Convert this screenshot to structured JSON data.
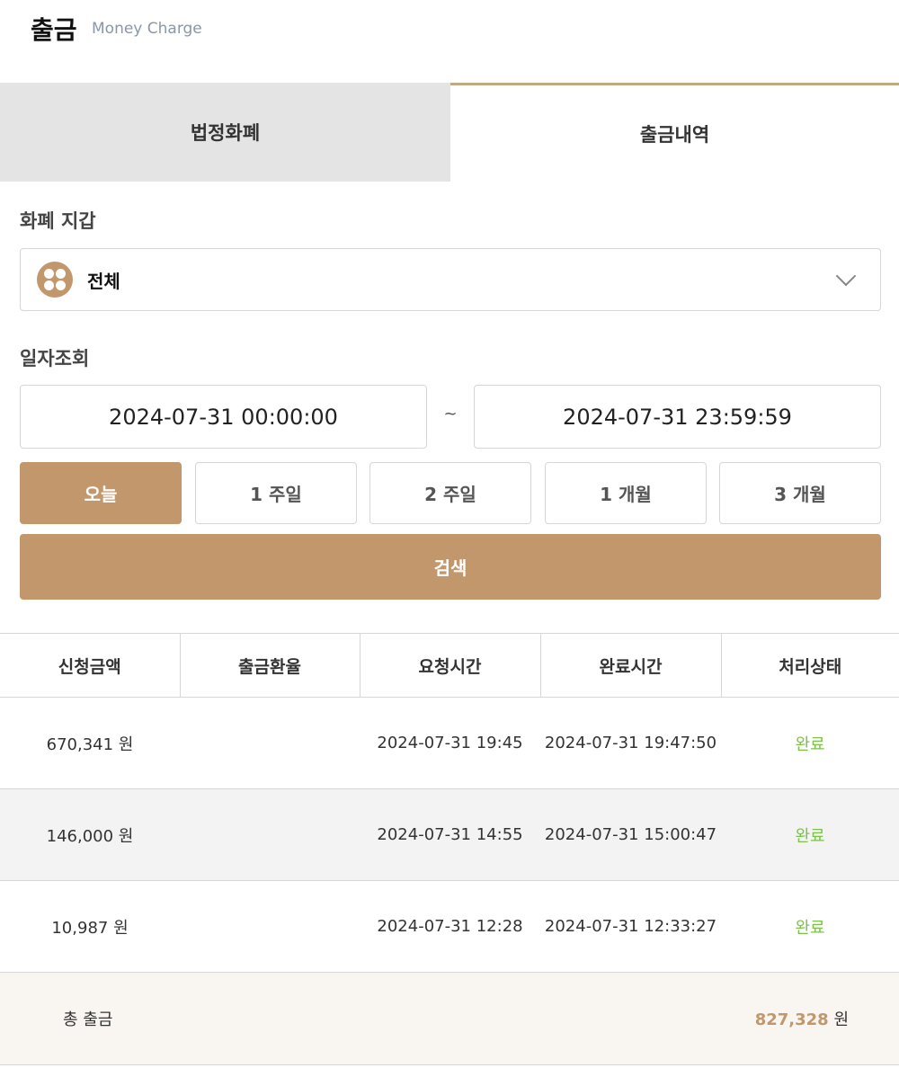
{
  "header": {
    "title": "출금",
    "subtitle": "Money Charge"
  },
  "tabs": [
    {
      "label": "법정화폐",
      "active": false
    },
    {
      "label": "출금내역",
      "active": true
    }
  ],
  "wallet": {
    "label": "화폐 지갑",
    "selected": "전체",
    "icon": "coin-icon"
  },
  "date_query": {
    "label": "일자조회",
    "start": "2024-07-31 00:00:00",
    "separator": "~",
    "end": "2024-07-31 23:59:59"
  },
  "periods": [
    {
      "label": "오늘",
      "active": true
    },
    {
      "label": "1 주일"
    },
    {
      "label": "2 주일"
    },
    {
      "label": "1 개월"
    },
    {
      "label": "3 개월"
    }
  ],
  "search_label": "검색",
  "accent": "#c1976b",
  "table": {
    "headers": [
      "신청금액",
      "출금환율",
      "요청시간",
      "완료시간",
      "처리상태"
    ],
    "rows": [
      {
        "amount": "670,341 원",
        "rate": "",
        "requested": "2024-07-31 19:45",
        "completed": "2024-07-31 19:47:50",
        "status": "완료"
      },
      {
        "amount": "146,000 원",
        "rate": "",
        "requested": "2024-07-31 14:55",
        "completed": "2024-07-31 15:00:47",
        "status": "완료"
      },
      {
        "amount": "10,987 원",
        "rate": "",
        "requested": "2024-07-31 12:28",
        "completed": "2024-07-31 12:33:27",
        "status": "완료"
      }
    ],
    "total": {
      "label": "총 출금",
      "amount": "827,328",
      "unit": "원"
    }
  }
}
